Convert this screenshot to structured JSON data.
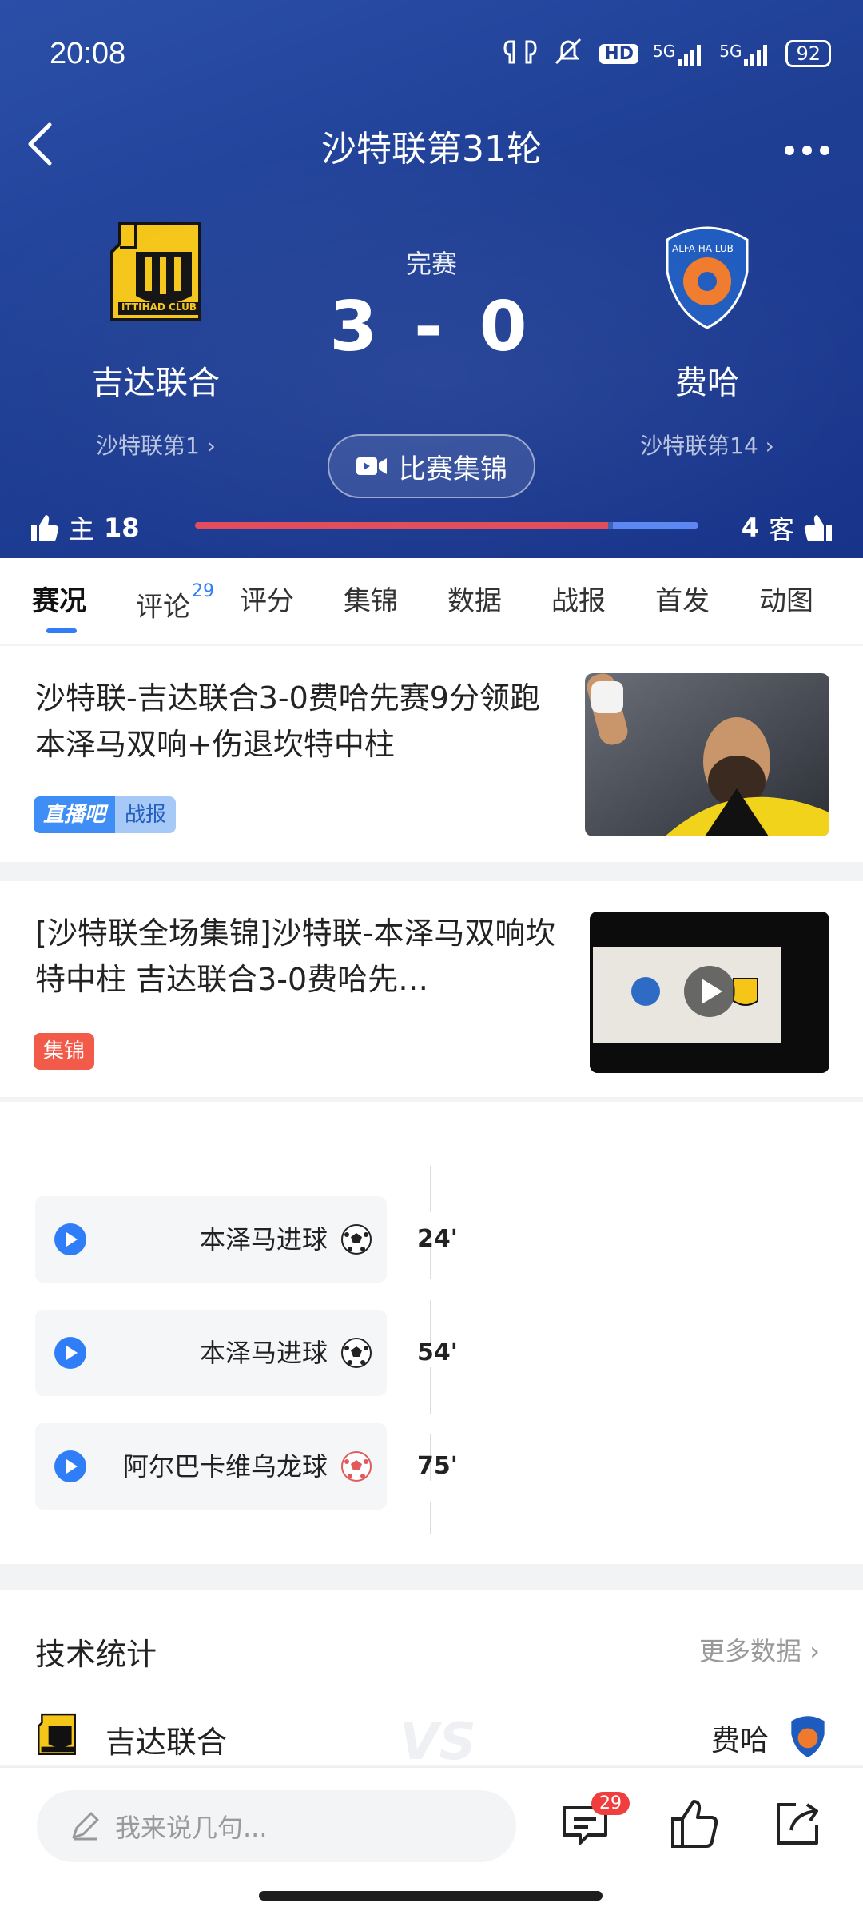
{
  "status_bar": {
    "time": "20:08",
    "network": "5G",
    "network2": "5G",
    "hd": "HD",
    "battery": "92"
  },
  "header": {
    "title": "沙特联第31轮",
    "match_status": "完赛",
    "score": "3 - 0",
    "highlights_button": "比赛集锦",
    "home": {
      "name": "吉达联合",
      "rank": "沙特联第1",
      "logo_text": "ITTIHAD CLUB"
    },
    "away": {
      "name": "费哈",
      "rank": "沙特联第14",
      "logo_text": "ALFA HA LUB"
    },
    "votes": {
      "home_label": "主",
      "home_count": "18",
      "away_label": "客",
      "away_count": "4",
      "home_share": 0.82
    }
  },
  "tabs": [
    {
      "label": "赛况"
    },
    {
      "label": "评论",
      "badge": "29"
    },
    {
      "label": "评分"
    },
    {
      "label": "集锦"
    },
    {
      "label": "数据"
    },
    {
      "label": "战报"
    },
    {
      "label": "首发"
    },
    {
      "label": "动图"
    }
  ],
  "news": [
    {
      "title": "沙特联-吉达联合3-0费哈先赛9分领跑 本泽马双响+伤退坎特中柱",
      "tag1": "直播吧",
      "tag2": "战报"
    },
    {
      "title": "[沙特联全场集锦]沙特联-本泽马双响坎特中柱 吉达联合3-0费哈先…",
      "tag1": "集锦"
    }
  ],
  "events": [
    {
      "label": "本泽马进球",
      "minute": "24'",
      "type": "goal"
    },
    {
      "label": "本泽马进球",
      "minute": "54'",
      "type": "goal"
    },
    {
      "label": "阿尔巴卡维乌龙球",
      "minute": "75'",
      "type": "own-goal"
    }
  ],
  "stats": {
    "title": "技术统计",
    "more": "更多数据",
    "home": "吉达联合",
    "away": "费哈",
    "vs": "VS"
  },
  "bottom": {
    "placeholder": "我来说几句...",
    "comment_count": "29"
  },
  "colors": {
    "header_blue": "#1f3f95",
    "accent_blue": "#2f7ef7",
    "vote_red": "#e24a5a"
  }
}
